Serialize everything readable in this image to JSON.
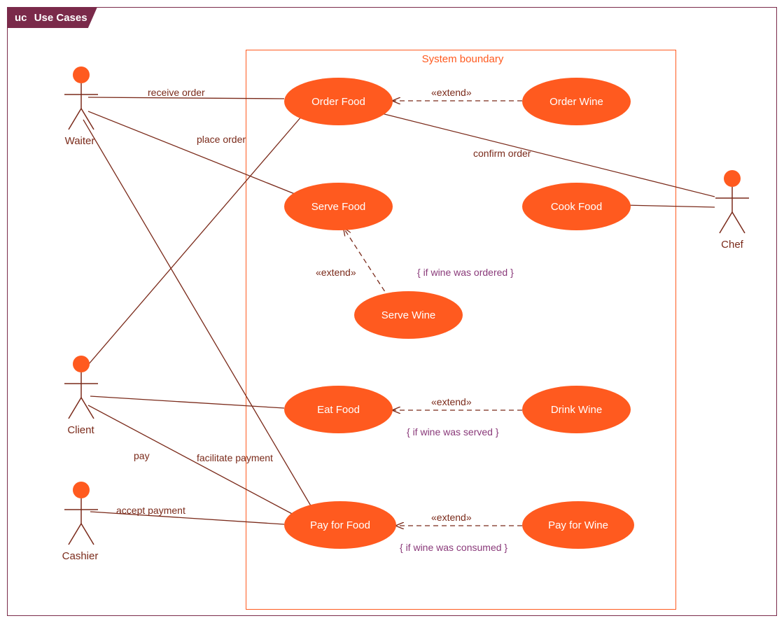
{
  "frame": {
    "uc_prefix": "uc",
    "title": "Use Cases"
  },
  "system_boundary": {
    "label": "System boundary"
  },
  "actors": {
    "waiter": {
      "label": "Waiter"
    },
    "chef": {
      "label": "Chef"
    },
    "client": {
      "label": "Client"
    },
    "cashier": {
      "label": "Cashier"
    }
  },
  "usecases": {
    "order_food": {
      "label": "Order Food"
    },
    "order_wine": {
      "label": "Order Wine"
    },
    "serve_food": {
      "label": "Serve Food"
    },
    "cook_food": {
      "label": "Cook Food"
    },
    "serve_wine": {
      "label": "Serve Wine"
    },
    "eat_food": {
      "label": "Eat Food"
    },
    "drink_wine": {
      "label": "Drink Wine"
    },
    "pay_for_food": {
      "label": "Pay for Food"
    },
    "pay_for_wine": {
      "label": "Pay for Wine"
    }
  },
  "assoc_labels": {
    "receive_order": "receive order",
    "place_order": "place order",
    "confirm_order": "confirm order",
    "facilitate_payment": "facilitate payment",
    "pay": "pay",
    "accept_payment": "accept payment"
  },
  "extend_label": "«extend»",
  "constraints": {
    "wine_ordered": "{ if wine was ordered }",
    "wine_served": "{ if wine was served }",
    "wine_consumed": "{ if wine was consumed }"
  }
}
